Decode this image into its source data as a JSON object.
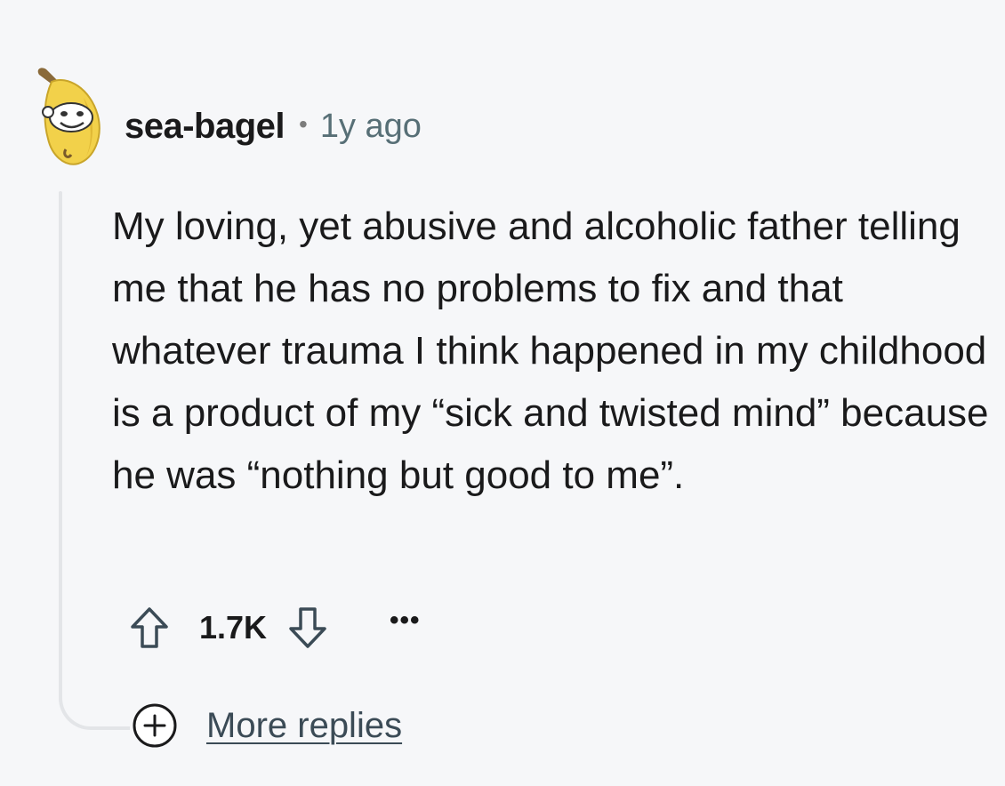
{
  "comment": {
    "author": "sea-bagel",
    "separator": "•",
    "timestamp": "1y ago",
    "avatar_icon": "banana-snoo-avatar-icon",
    "body": "My loving, yet abusive and alcoholic father telling me that he has no problems to fix and that whatever trauma I think happened in my childhood is a product of my “sick and twisted mind” because he was “nothing but good to me”."
  },
  "actions": {
    "score": "1.7K",
    "upvote_icon": "upvote-arrow-icon",
    "downvote_icon": "downvote-arrow-icon",
    "overflow_label": "•••"
  },
  "more_replies": {
    "label": "More replies",
    "icon": "plus-circle-icon"
  },
  "colors": {
    "background": "#f6f7f9",
    "text": "#1a1a1b",
    "muted": "#576f76",
    "thread_line": "#e3e5e8"
  }
}
